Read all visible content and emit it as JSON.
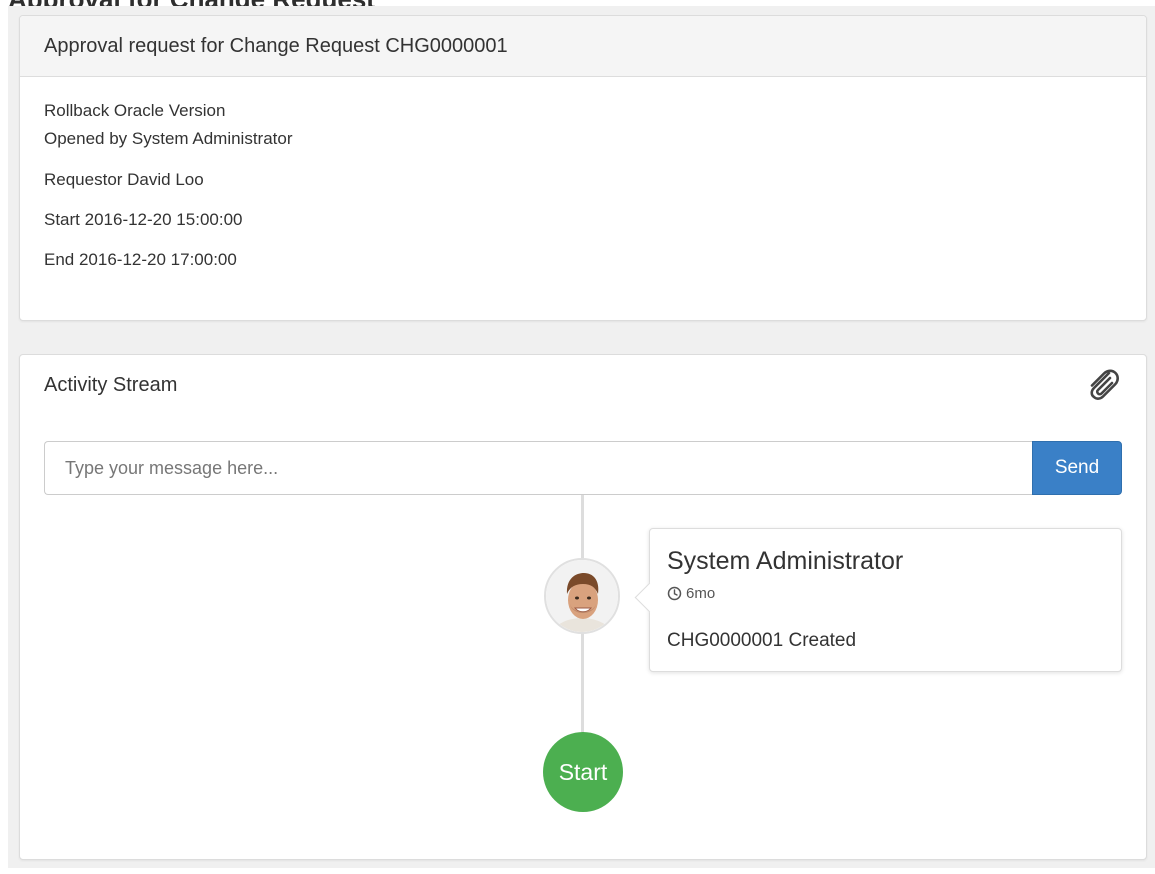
{
  "page": {
    "title": "Approval for Change Request"
  },
  "approval_panel": {
    "heading": "Approval request for Change Request CHG0000001",
    "short_description": "Rollback Oracle Version",
    "opened_by": "Opened by System Administrator",
    "requestor": "Requestor David Loo",
    "start": "Start 2016-12-20 15:00:00",
    "end": "End 2016-12-20 17:00:00"
  },
  "activity_stream": {
    "title": "Activity Stream",
    "attach_icon": "paperclip-icon",
    "message_input": {
      "placeholder": "Type your message here...",
      "value": ""
    },
    "send_label": "Send",
    "send_color": "#3a80c7",
    "entries": [
      {
        "author": "System Administrator",
        "time_icon": "clock-icon",
        "time": "6mo",
        "text": "CHG0000001 Created",
        "avatar_icon": "user-avatar"
      }
    ],
    "start_badge": {
      "label": "Start",
      "color": "#4caf50"
    }
  }
}
